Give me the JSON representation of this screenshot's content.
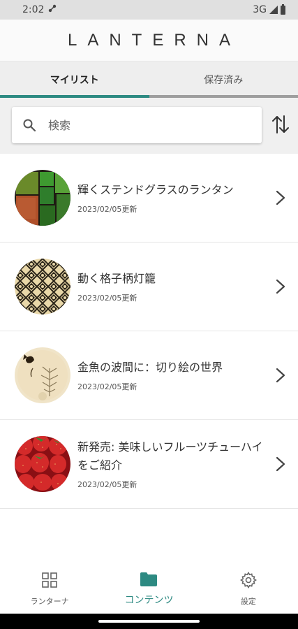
{
  "status_bar": {
    "time": "2:02",
    "network": "3G"
  },
  "app": {
    "title": "LANTERNA"
  },
  "tabs": [
    {
      "label": "マイリスト",
      "active": true
    },
    {
      "label": "保存済み",
      "active": false
    }
  ],
  "search": {
    "placeholder": "検索",
    "value": ""
  },
  "items": [
    {
      "title": "輝くステンドグラスのランタン",
      "date": "2023/02/05更新",
      "thumbnail": "stained-glass"
    },
    {
      "title": "動く格子柄灯籠",
      "date": "2023/02/05更新",
      "thumbnail": "lattice-pattern"
    },
    {
      "title": "金魚の波間に：切り絵の世界",
      "date": "2023/02/05更新",
      "thumbnail": "goldfish-papercut"
    },
    {
      "title": "新発売: 美味しいフルーツチューハイをご紹介",
      "date": "2023/02/05更新",
      "thumbnail": "strawberries"
    }
  ],
  "bottom_nav": [
    {
      "label": "ランターナ",
      "icon": "grid-icon",
      "active": false
    },
    {
      "label": "コンテンツ",
      "icon": "folder-icon",
      "active": true
    },
    {
      "label": "設定",
      "icon": "gear-icon",
      "active": false
    }
  ],
  "colors": {
    "accent": "#2d8a82",
    "tab_bg": "#eeeeee",
    "search_bg": "#f0f0f0"
  }
}
